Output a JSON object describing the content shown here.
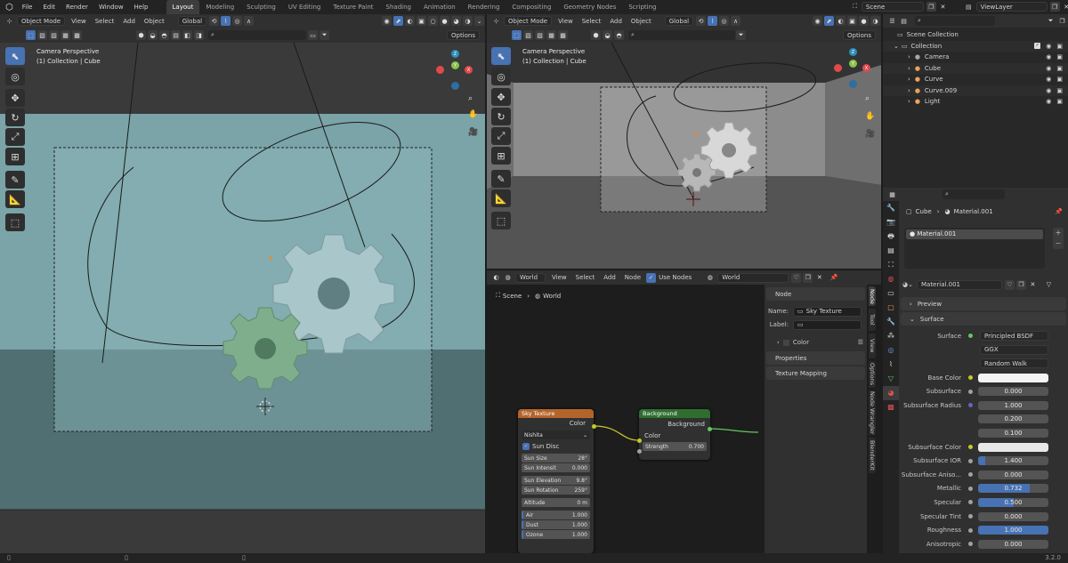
{
  "topbar": {
    "menus": [
      "File",
      "Edit",
      "Render",
      "Window",
      "Help"
    ],
    "workspaces": [
      "Layout",
      "Modeling",
      "Sculpting",
      "UV Editing",
      "Texture Paint",
      "Shading",
      "Animation",
      "Rendering",
      "Compositing",
      "Geometry Nodes",
      "Scripting"
    ],
    "active_workspace": "Layout",
    "scene": "Scene",
    "viewlayer": "ViewLayer"
  },
  "vp_left": {
    "mode": "Object Mode",
    "menus": [
      "View",
      "Select",
      "Add",
      "Object"
    ],
    "orientation": "Global",
    "options": "Options",
    "title": "Camera Perspective",
    "subtitle": "(1) Collection | Cube"
  },
  "vp_right": {
    "mode": "Object Mode",
    "menus": [
      "View",
      "Select",
      "Add",
      "Object"
    ],
    "orientation": "Global",
    "options": "Options",
    "title": "Camera Perspective",
    "subtitle": "(1) Collection | Cube"
  },
  "gizmo": {
    "x": "X",
    "y": "Y",
    "z": "Z"
  },
  "outliner": {
    "root": "Scene Collection",
    "collection": "Collection",
    "items": [
      {
        "name": "Camera",
        "color": "#a8a8a8"
      },
      {
        "name": "Cube",
        "color": "#e8a45c"
      },
      {
        "name": "Curve",
        "color": "#e8a45c"
      },
      {
        "name": "Curve.009",
        "color": "#e8a45c"
      },
      {
        "name": "Light",
        "color": "#e8a45c"
      }
    ]
  },
  "node_editor": {
    "world_type": "World",
    "menus": [
      "View",
      "Select",
      "Add",
      "Node"
    ],
    "use_nodes": "Use Nodes",
    "world_name": "World",
    "breadcrumb_scene": "Scene",
    "breadcrumb_world": "World",
    "sky_node": {
      "title": "Sky Texture",
      "out": "Color",
      "type": "Nishita",
      "sun_disc": "Sun Disc",
      "fields": [
        {
          "l": "Sun Size",
          "v": "28°"
        },
        {
          "l": "Sun Intensit",
          "v": "0.000"
        },
        {
          "l": "Sun Elevation",
          "v": "9.8°"
        },
        {
          "l": "Sun Rotation",
          "v": "259°"
        },
        {
          "l": "Altitude",
          "v": "0 m"
        },
        {
          "l": "Air",
          "v": "1.000"
        },
        {
          "l": "Dust",
          "v": "1.000"
        },
        {
          "l": "Ozone",
          "v": "1.000"
        }
      ]
    },
    "bg_node": {
      "title": "Background",
      "out": "Background",
      "in_color": "Color",
      "strength_label": "Strength",
      "strength": "0.700"
    },
    "npanel": {
      "node": "Node",
      "name_label": "Name:",
      "name": "Sky Texture",
      "label_label": "Label:",
      "color": "Color",
      "properties": "Properties",
      "texture_mapping": "Texture Mapping"
    },
    "tabs": [
      "Node",
      "Tool",
      "View",
      "Options",
      "Node Wrangler",
      "BlenderKit"
    ]
  },
  "properties": {
    "crumb_obj": "Cube",
    "crumb_mat": "Material.001",
    "slot": "Material.001",
    "mat_name": "Material.001",
    "preview": "Preview",
    "surface": "Surface",
    "surface_label": "Surface",
    "shader": "Principled BSDF",
    "dist": "GGX",
    "sss_method": "Random Walk",
    "rows": [
      {
        "l": "Base Color",
        "type": "color",
        "c": "#f4f4f4",
        "dot": "y"
      },
      {
        "l": "Subsurface",
        "v": "0.000",
        "f": 0,
        "dot": "g"
      },
      {
        "l": "Subsurface Radius",
        "v": "1.000",
        "f": 0,
        "dot": "p"
      },
      {
        "l": "",
        "v": "0.200",
        "f": 0,
        "dot": ""
      },
      {
        "l": "",
        "v": "0.100",
        "f": 0,
        "dot": ""
      },
      {
        "l": "Subsurface Color",
        "type": "color",
        "c": "#e8e8e8",
        "dot": "y"
      },
      {
        "l": "Subsurface IOR",
        "v": "1.400",
        "f": 0.1,
        "dot": "g"
      },
      {
        "l": "Subsurface Aniso...",
        "v": "0.000",
        "f": 0,
        "dot": "g"
      },
      {
        "l": "Metallic",
        "v": "0.732",
        "f": 0.732,
        "dot": "g"
      },
      {
        "l": "Specular",
        "v": "0.500",
        "f": 0.5,
        "dot": "g"
      },
      {
        "l": "Specular Tint",
        "v": "0.000",
        "f": 0,
        "dot": "g"
      },
      {
        "l": "Roughness",
        "v": "1.000",
        "f": 1,
        "dot": "g"
      },
      {
        "l": "Anisotropic",
        "v": "0.000",
        "f": 0,
        "dot": "g"
      }
    ]
  },
  "status": {
    "version": "3.2.0"
  }
}
